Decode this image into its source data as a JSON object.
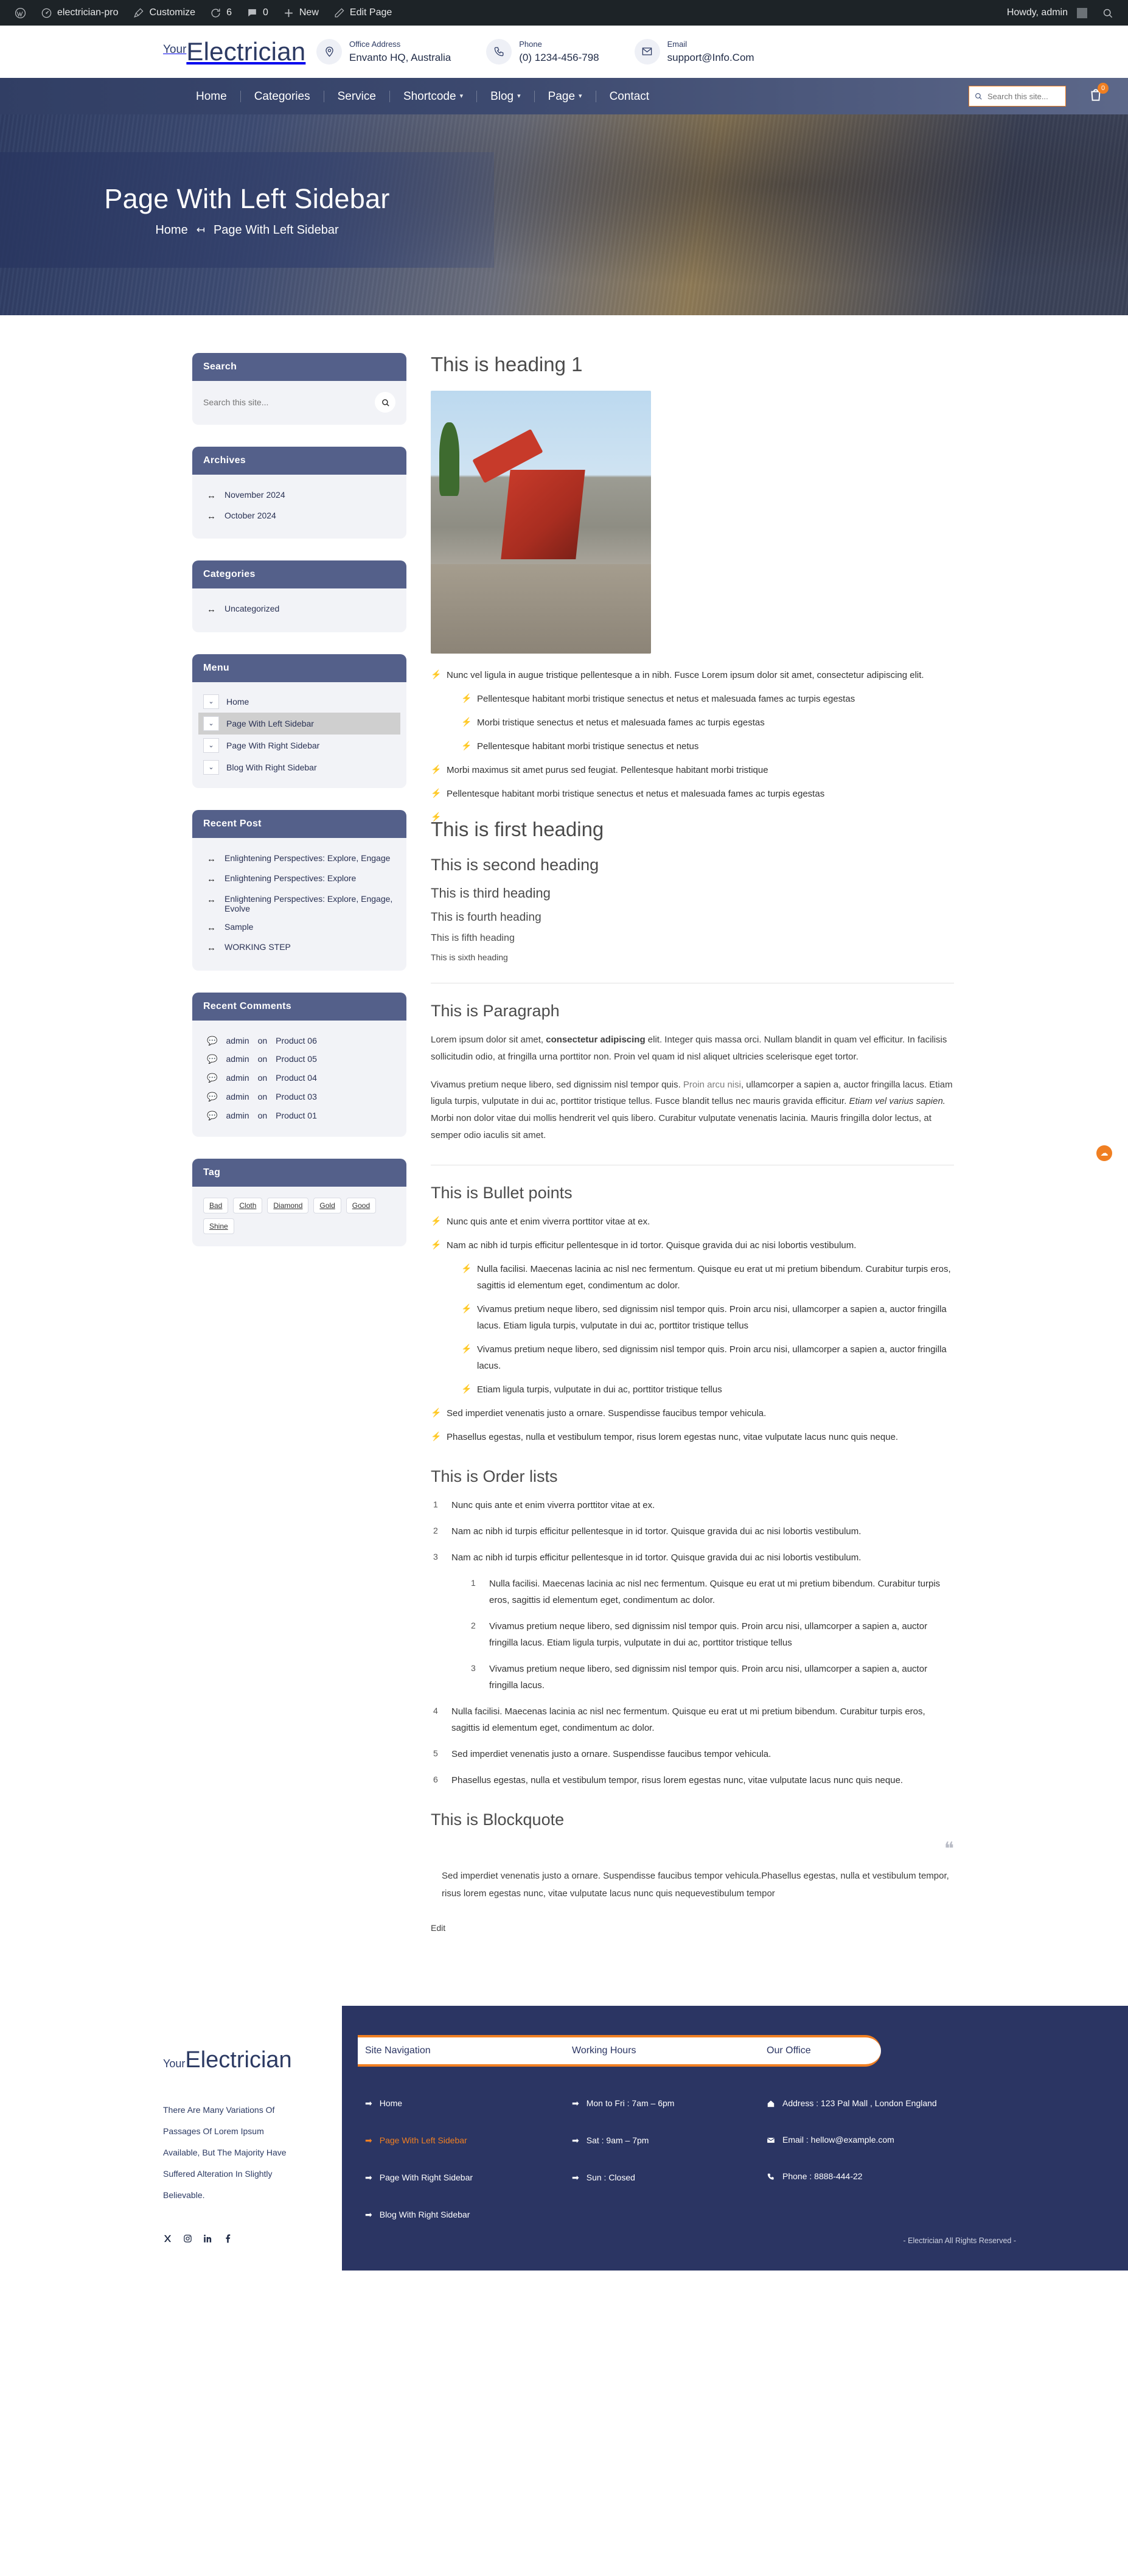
{
  "adminbar": {
    "wp_logo": "wordpress-icon",
    "site_name": "electrician-pro",
    "customize": "Customize",
    "updates_count": "6",
    "comments_count": "0",
    "new": "New",
    "edit_page": "Edit Page",
    "howdy": "Howdy, admin"
  },
  "header": {
    "logo_pre": "Your",
    "logo_main": "Electrician",
    "contacts": [
      {
        "icon": "location-pin-icon",
        "label": "Office Address",
        "value": "Envanto HQ, Australia"
      },
      {
        "icon": "phone-icon",
        "label": "Phone",
        "value": "(0) 1234-456-798"
      },
      {
        "icon": "envelope-icon",
        "label": "Email",
        "value": "support@Info.Com"
      }
    ]
  },
  "nav": {
    "items": [
      {
        "label": "Home",
        "has_dropdown": false
      },
      {
        "label": "Categories",
        "has_dropdown": false
      },
      {
        "label": "Service",
        "has_dropdown": false
      },
      {
        "label": "Shortcode",
        "has_dropdown": true
      },
      {
        "label": "Blog",
        "has_dropdown": true
      },
      {
        "label": "Page",
        "has_dropdown": true
      },
      {
        "label": "Contact",
        "has_dropdown": false
      }
    ],
    "search_placeholder": "Search this site...",
    "cart_count": "0"
  },
  "banner": {
    "title": "Page With Left Sidebar",
    "crumb_home": "Home",
    "crumb_sep": "↤",
    "crumb_current": "Page With Left Sidebar"
  },
  "sidebar": {
    "search": {
      "title": "Search",
      "placeholder": "Search this site..."
    },
    "archives": {
      "title": "Archives",
      "items": [
        "November 2024",
        "October 2024"
      ]
    },
    "categories": {
      "title": "Categories",
      "items": [
        "Uncategorized"
      ]
    },
    "menu": {
      "title": "Menu",
      "items": [
        {
          "label": "Home",
          "active": false
        },
        {
          "label": "Page With Left Sidebar",
          "active": true
        },
        {
          "label": "Page With Right Sidebar",
          "active": false
        },
        {
          "label": "Blog With Right Sidebar",
          "active": false
        }
      ]
    },
    "recent_post": {
      "title": "Recent Post",
      "items": [
        "Enlightening Perspectives: Explore, Engage",
        "Enlightening Perspectives: Explore",
        "Enlightening Perspectives: Explore, Engage, Evolve",
        "Sample",
        "WORKING STEP"
      ]
    },
    "recent_comments": {
      "title": "Recent Comments",
      "items": [
        {
          "author": "admin",
          "on": "on",
          "post": "Product 06"
        },
        {
          "author": "admin",
          "on": "on",
          "post": "Product 05"
        },
        {
          "author": "admin",
          "on": "on",
          "post": "Product 04"
        },
        {
          "author": "admin",
          "on": "on",
          "post": "Product 03"
        },
        {
          "author": "admin",
          "on": "on",
          "post": "Product 01"
        }
      ]
    },
    "tag": {
      "title": "Tag",
      "items": [
        "Bad",
        "Cloth",
        "Diamond",
        "Gold",
        "Good",
        "Shine"
      ]
    }
  },
  "content": {
    "h1": "This is heading 1",
    "intro": "Nunc vel ligula in augue tristique pellentesque a in nibh. Fusce Lorem ipsum dolor sit amet, consectetur adipiscing elit.",
    "intro_sub": [
      "Pellentesque habitant morbi tristique senectus et netus et malesuada fames ac turpis egestas",
      "Morbi tristique senectus et netus et malesuada fames ac turpis egestas",
      "Pellentesque habitant morbi tristique senectus et netus"
    ],
    "intro_after": [
      "Morbi maximus sit amet purus sed feugiat. Pellentesque habitant morbi tristique",
      "Pellentesque habitant morbi tristique senectus et netus et malesuada fames ac turpis egestas",
      ""
    ],
    "headings": {
      "first": "This is first heading",
      "second": "This is second heading",
      "third": "This is third heading",
      "fourth": "This is fourth heading",
      "fifth": "This is fifth heading",
      "sixth": "This is sixth heading"
    },
    "paragraph": {
      "title": "This is Paragraph",
      "p1_a": "Lorem ipsum dolor sit amet, ",
      "p1_bold": "consectetur adipiscing",
      "p1_b": " elit. Integer quis massa orci. Nullam blandit in quam vel efficitur. In facilisis sollicitudin odio, at fringilla urna porttitor non. Proin vel quam id nisl aliquet ultricies scelerisque eget tortor.",
      "p2_a": "Vivamus pretium neque libero, sed dignissim nisl tempor quis. ",
      "p2_link": "Proin arcu nisi",
      "p2_b": ", ullamcorper a sapien a, auctor fringilla lacus. Etiam ligula turpis, vulputate in dui ac, porttitor tristique tellus. Fusce blandit tellus nec mauris gravida efficitur. ",
      "p2_italic": "Etiam vel varius sapien.",
      "p2_c": " Morbi non dolor vitae dui mollis hendrerit vel quis libero. Curabitur vulputate venenatis lacinia. Mauris fringilla dolor lectus, at semper odio iaculis sit amet."
    },
    "bullets": {
      "title": "This is Bullet points",
      "items": [
        "Nunc quis ante et enim viverra porttitor vitae at ex.",
        "Nam ac nibh id turpis efficitur pellentesque in id tortor. Quisque gravida dui ac nisi lobortis vestibulum."
      ],
      "sub_items": [
        "Nulla facilisi. Maecenas lacinia ac nisl nec fermentum. Quisque eu erat ut mi pretium bibendum. Curabitur turpis eros, sagittis id elementum eget, condimentum ac dolor.",
        "Vivamus pretium neque libero, sed dignissim nisl tempor quis. Proin arcu nisi, ullamcorper a sapien a, auctor fringilla lacus. Etiam ligula turpis, vulputate in dui ac, porttitor tristique tellus",
        "Vivamus pretium neque libero, sed dignissim nisl tempor quis. Proin arcu nisi, ullamcorper a sapien a, auctor fringilla lacus.",
        "Etiam ligula turpis, vulputate in dui ac, porttitor tristique tellus"
      ],
      "tail_items": [
        "Sed imperdiet venenatis justo a ornare. Suspendisse faucibus tempor vehicula.",
        "Phasellus egestas, nulla et vestibulum tempor, risus lorem egestas nunc, vitae vulputate lacus nunc quis neque."
      ]
    },
    "orders": {
      "title": "This is Order lists",
      "items": [
        "Nunc quis ante et enim viverra porttitor vitae at ex.",
        "Nam ac nibh id turpis efficitur pellentesque in id tortor. Quisque gravida dui ac nisi lobortis vestibulum.",
        "Nam ac nibh id turpis efficitur pellentesque in id tortor. Quisque gravida dui ac nisi lobortis vestibulum."
      ],
      "sub_items": [
        "Nulla facilisi. Maecenas lacinia ac nisl nec fermentum. Quisque eu erat ut mi pretium bibendum. Curabitur turpis eros, sagittis id elementum eget, condimentum ac dolor.",
        "Vivamus pretium neque libero, sed dignissim nisl tempor quis. Proin arcu nisi, ullamcorper a sapien a, auctor fringilla lacus. Etiam ligula turpis, vulputate in dui ac, porttitor tristique tellus",
        "Vivamus pretium neque libero, sed dignissim nisl tempor quis. Proin arcu nisi, ullamcorper a sapien a, auctor fringilla lacus."
      ],
      "tail_items": [
        "Nulla facilisi. Maecenas lacinia ac nisl nec fermentum. Quisque eu erat ut mi pretium bibendum. Curabitur turpis eros, sagittis id elementum eget, condimentum ac dolor.",
        "Sed imperdiet venenatis justo a ornare. Suspendisse faucibus tempor vehicula.",
        "Phasellus egestas, nulla et vestibulum tempor, risus lorem egestas nunc, vitae vulputate lacus nunc quis neque."
      ]
    },
    "blockquote": {
      "title": "This is Blockquote",
      "text": "Sed imperdiet venenatis justo a ornare. Suspendisse faucibus tempor vehicula.Phasellus egestas, nulla et vestibulum tempor, risus lorem egestas nunc, vitae vulputate lacus nunc quis nequevestibulum tempor",
      "edit": "Edit"
    }
  },
  "footer": {
    "logo_pre": "Your",
    "logo_main": "Electrician",
    "blurb": "There Are Many Variations Of Passages Of Lorem Ipsum Available, But The Majority Have Suffered Alteration In Slightly Believable.",
    "socials": [
      "x-icon",
      "instagram-icon",
      "linkedin-icon",
      "facebook-icon"
    ],
    "tabs": [
      "Site Navigation",
      "Working Hours",
      "Our Office"
    ],
    "site_navigation": [
      {
        "label": "Home",
        "active": false
      },
      {
        "label": "Page With Left Sidebar",
        "active": true
      },
      {
        "label": "Page With Right Sidebar",
        "active": false
      },
      {
        "label": "Blog With Right Sidebar",
        "active": false
      }
    ],
    "working_hours": [
      "Mon to Fri : 7am – 6pm",
      "Sat : 9am – 7pm",
      "Sun : Closed"
    ],
    "office": [
      {
        "icon": "home-icon",
        "text": "Address : 123 Pal Mall , London England"
      },
      {
        "icon": "envelope-icon",
        "text": "Email : hellow@example.com"
      },
      {
        "icon": "phone-icon",
        "text": "Phone : 8888-444-22"
      }
    ],
    "copyright": "- Electrician All Rights Reserved -"
  },
  "colors": {
    "accent": "#f07f22",
    "navy": "#2b3563",
    "widget_head": "#54608a",
    "widget_body": "#f2f3f7"
  }
}
